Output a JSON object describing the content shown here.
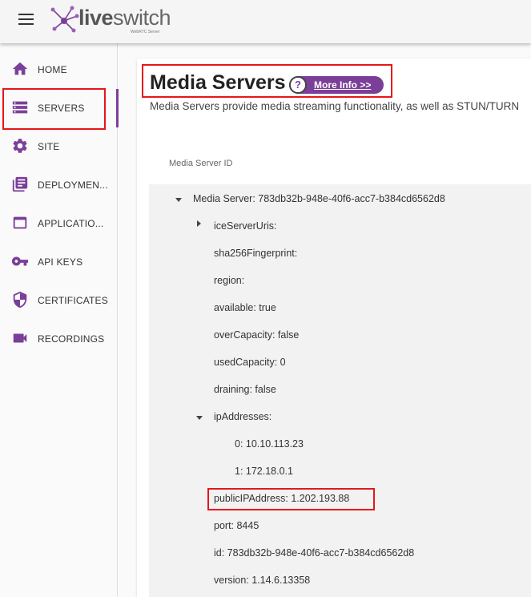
{
  "header": {
    "logo_text_live": "live",
    "logo_text_switch": "switch",
    "logo_subtitle": "WebRTC Server"
  },
  "sidebar": {
    "items": [
      {
        "label": "HOME",
        "icon": "home-icon"
      },
      {
        "label": "SERVERS",
        "icon": "servers-icon",
        "active": true
      },
      {
        "label": "SITE",
        "icon": "gear-icon"
      },
      {
        "label": "DEPLOYMEN...",
        "icon": "deployments-icon"
      },
      {
        "label": "APPLICATIO...",
        "icon": "applications-icon"
      },
      {
        "label": "API KEYS",
        "icon": "key-icon"
      },
      {
        "label": "CERTIFICATES",
        "icon": "shield-icon"
      },
      {
        "label": "RECORDINGS",
        "icon": "video-camera-icon"
      }
    ]
  },
  "main": {
    "title": "Media Servers",
    "more_info_label": "More Info >>",
    "description": "Media Servers provide media streaming functionality, as well as STUN/TURN",
    "column_header": "Media Server ID",
    "tree": {
      "root": "Media Server: 783db32b-948e-40f6-acc7-b384cd6562d8",
      "ice_server_uris": "iceServerUris:",
      "sha": "sha256Fingerprint:",
      "region": "region:",
      "available": "available: true",
      "over_capacity": "overCapacity: false",
      "used_capacity": "usedCapacity: 0",
      "draining": "draining: false",
      "ip_addresses": "ipAddresses:",
      "ip_0": "0: 10.10.113.23",
      "ip_1": "1: 172.18.0.1",
      "public_ip": "publicIPAddress: 1.202.193.88",
      "port": "port: 8445",
      "id": "id: 783db32b-948e-40f6-acc7-b384cd6562d8",
      "version": "version: 1.14.6.13358"
    }
  },
  "colors": {
    "accent": "#7b3f99",
    "highlight_border": "#e8151b",
    "tree_background": "#f2f2f2"
  }
}
